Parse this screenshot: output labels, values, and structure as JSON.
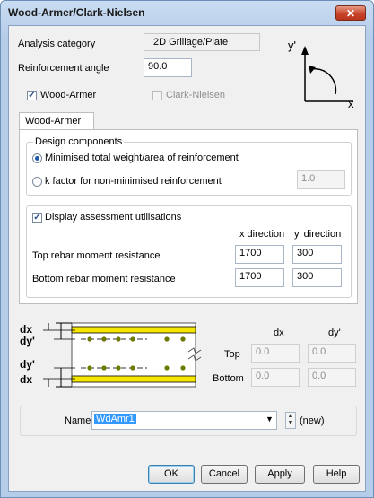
{
  "window": {
    "title": "Wood-Armer/Clark-Nielsen",
    "close_label": "✕"
  },
  "analysis": {
    "label": "Analysis category",
    "value": "2D Grillage/Plate"
  },
  "angle": {
    "label": "Reinforcement angle",
    "value": "90.0"
  },
  "axes": {
    "y_label": "y'",
    "x_label": "x"
  },
  "methods": {
    "wood_armer_label": "Wood-Armer",
    "wood_armer_checked": true,
    "clark_nielsen_label": "Clark-Nielsen",
    "clark_nielsen_checked": false
  },
  "tab": {
    "label": "Wood-Armer"
  },
  "design": {
    "group_label": "Design components",
    "option1_label": "Minimised total weight/area of reinforcement",
    "option2_label": "k factor for non-minimised reinforcement",
    "k_value": "1.0",
    "selected_option": 1
  },
  "assessment": {
    "checkbox_label": "Display assessment utilisations",
    "checked": true,
    "x_header": "x direction",
    "y_header": "y' direction",
    "top_label": "Top rebar moment resistance",
    "top_x": "1700",
    "top_y": "300",
    "bottom_label": "Bottom rebar moment resistance",
    "bottom_x": "1700",
    "bottom_y": "300"
  },
  "diagram": {
    "dx1": "dx",
    "dy1": "dy'",
    "dy2": "dy'",
    "dx2": "dx"
  },
  "depths": {
    "dx_header": "dx",
    "dy_header": "dy'",
    "top_label": "Top",
    "bottom_label": "Bottom",
    "top_dx": "0.0",
    "top_dy": "0.0",
    "bottom_dx": "0.0",
    "bottom_dy": "0.0"
  },
  "name": {
    "label": "Name",
    "value": "WdAmr1",
    "status": "(new)"
  },
  "buttons": {
    "ok": "OK",
    "cancel": "Cancel",
    "apply": "Apply",
    "help": "Help"
  },
  "colors": {
    "rebar_band": "#f5e600",
    "rebar_dot": "#6f7a00"
  }
}
